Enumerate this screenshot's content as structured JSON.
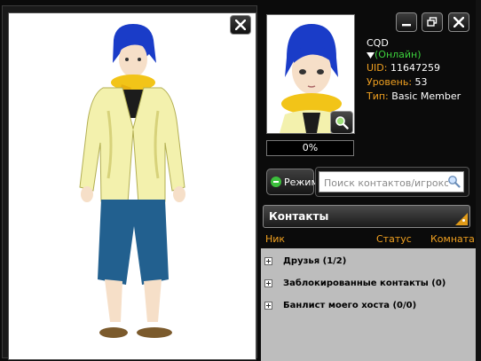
{
  "profile": {
    "name": "CQD",
    "status": "(Онлайн)",
    "uid_label": "UID:",
    "uid_value": "11647259",
    "level_label": "Уровень:",
    "level_value": "53",
    "type_label": "Тип:",
    "type_value": "Basic Member"
  },
  "progress": {
    "text": "0%",
    "value": 0
  },
  "mode_button": {
    "label": "Режим"
  },
  "search": {
    "placeholder": "Поиск контактов/игроков"
  },
  "contacts": {
    "title": "Контакты",
    "columns": {
      "nick": "Ник",
      "status": "Статус",
      "room": "Комната"
    },
    "groups": [
      {
        "label": "Друзья (1/2)"
      },
      {
        "label": "Заблокированные контакты (0)"
      },
      {
        "label": "Банлист моего хоста (0/0)"
      }
    ]
  },
  "icons": {
    "viewer_close": "close-icon",
    "window_minimize": "minimize-icon",
    "window_restore": "restore-icon",
    "window_close": "close-icon",
    "zoom": "magnifier-icon",
    "search": "search-icon",
    "mode": "minus-circle-icon",
    "status_dropdown": "triangle-down-icon"
  },
  "colors": {
    "label_orange": "#f0a020",
    "online_green": "#3cd23c",
    "list_bg": "#bdbdbd",
    "accent_orange": "#e09a18"
  }
}
